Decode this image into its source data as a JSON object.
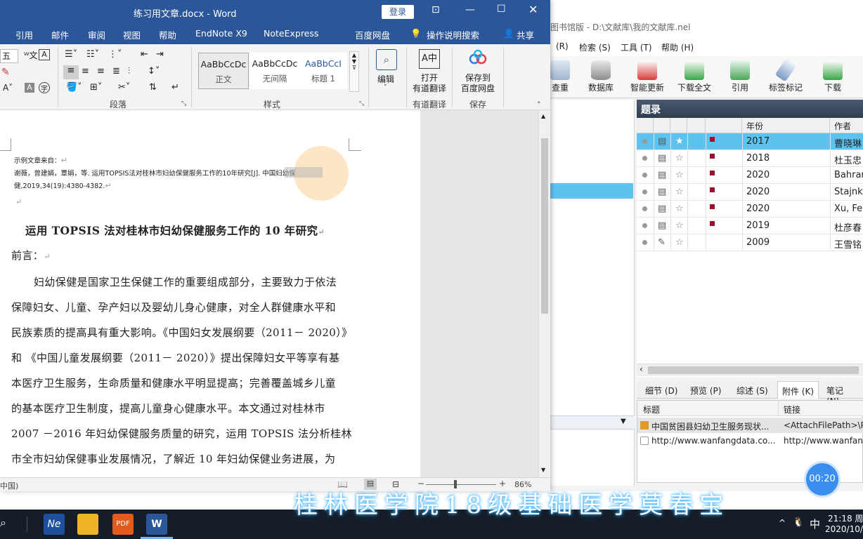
{
  "word": {
    "title": "练习用文章.docx  -  Word",
    "login_label": "登录",
    "tabs": [
      "引用",
      "邮件",
      "审阅",
      "视图",
      "帮助",
      "EndNote X9",
      "NoteExpress",
      "百度网盘",
      "操作说明搜索",
      "共享"
    ],
    "ribbon": {
      "font_size_frag": "五",
      "styles": [
        {
          "preview": "AaBbCcDc",
          "name": "正文"
        },
        {
          "preview": "AaBbCcDc",
          "name": "无间隔"
        },
        {
          "preview": "AaBbCcI",
          "name": "标题 1"
        }
      ],
      "edit_label": "编辑",
      "translate_label": "打开\n有道翻译",
      "baidu_label": "保存到\n百度网盘",
      "group_paragraph": "段落",
      "group_styles": "样式",
      "group_translate": "有道翻译",
      "group_save": "保存"
    },
    "doc": {
      "source_label": "示例文章来自：",
      "citation_line1": "谢薇，曾建娟，覃娟，等. 运用TOPSIS法对桂林市妇幼保健服务工作的10年研究[J]. 中国妇幼保",
      "citation_line2": "健,2019,34(19):4380-4382.",
      "title": "运用 TOPSIS 法对桂林市妇幼保健服务工作的 10 年研究",
      "preface": "前言：",
      "lines": [
        "妇幼保健是国家卫生保健工作的重要组成部分，主要致力于依法",
        "保障妇女、儿童、孕产妇以及婴幼儿身心健康，对全人群健康水平和",
        "民族素质的提高具有重大影响。《中国妇女发展纲要（2011－ 2020）》",
        "和 《中国儿童发展纲要（2011－ 2020）》提出保障妇女平等享有基",
        "本医疗卫生服务，生命质量和健康水平明显提高；完善覆盖城乡儿童",
        "的基本医疗卫生制度，提高儿童身心健康水平。本文通过对桂林市",
        "2007 －2016 年妇幼保健服务质量的研究，运用  TOPSIS 法分析桂林",
        "市全市妇幼保健事业发展情况，了解近  10  年妇幼保健业务进展，为"
      ]
    },
    "status": {
      "lang": "中国)",
      "zoom": "86%"
    }
  },
  "noteexpress": {
    "title": "图书馆版 - D:\\文献库\\我的文献库.nel",
    "menu": [
      "(R)",
      "检索 (S)",
      "工具 (T)",
      "帮助 (H)"
    ],
    "toolbar": [
      "查重",
      "数据库",
      "智能更新",
      "下载全文",
      "引用",
      "标签标记",
      "下载"
    ],
    "grid_title": "题录",
    "grid_cols": {
      "year": "年份",
      "author": "作者"
    },
    "rows": [
      {
        "year": "2017",
        "author": "曹晓琳",
        "selected": true,
        "flag": true,
        "icon": "doc"
      },
      {
        "year": "2018",
        "author": "杜玉忠",
        "selected": false,
        "flag": true,
        "icon": "doc"
      },
      {
        "year": "2020",
        "author": "Bahran",
        "selected": false,
        "flag": true,
        "icon": "doc"
      },
      {
        "year": "2020",
        "author": "Stajnk",
        "selected": false,
        "flag": true,
        "icon": "doc"
      },
      {
        "year": "2020",
        "author": "Xu, Fe",
        "selected": false,
        "flag": true,
        "icon": "doc"
      },
      {
        "year": "2019",
        "author": "杜彦春",
        "selected": false,
        "flag": true,
        "icon": "doc"
      },
      {
        "year": "2009",
        "author": "王雪铭",
        "selected": false,
        "flag": false,
        "icon": "pen"
      }
    ],
    "detail_tabs": [
      "细节 (D)",
      "预览 (P)",
      "综述 (S)",
      "附件 (K)",
      "笔记 (N)"
    ],
    "attach_cols": {
      "title": "标题",
      "link": "链接"
    },
    "attachments": [
      {
        "title": "中国贫困县妇幼卫生服务现状...",
        "link": "<AttachFilePath>\\P"
      },
      {
        "title": "http://www.wanfangdata.co...",
        "link": "http://www.wanfang"
      }
    ],
    "timer": "00:20"
  },
  "taskbar": {
    "ime": "中",
    "time": "21:18 周",
    "date": "2020/10/"
  },
  "caption": "桂林医学院18级基础医学莫春宝",
  "colors": {
    "word_blue": "#2b579a",
    "ne_select": "#5ec2ee",
    "flag_red": "#a0102a"
  }
}
